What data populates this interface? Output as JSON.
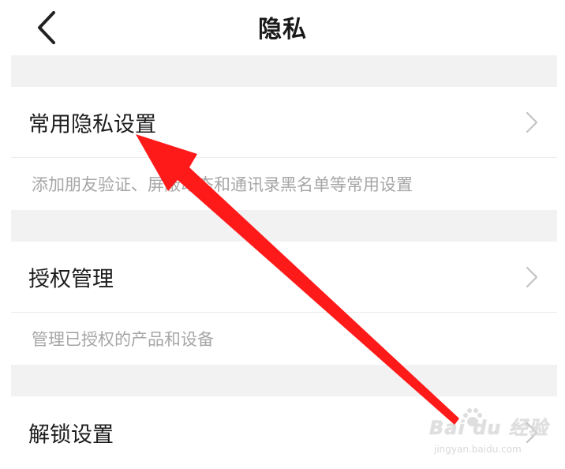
{
  "header": {
    "title": "隐私",
    "back_icon": "chevron-left-icon"
  },
  "items": [
    {
      "label": "常用隐私设置",
      "description": "添加朋友验证、屏蔽动态和通讯录黑名单等常用设置"
    },
    {
      "label": "授权管理",
      "description": "管理已授权的产品和设备"
    },
    {
      "label": "解锁设置"
    }
  ],
  "watermark": {
    "brand": "Bai du 经验",
    "url": "jingyan.baidu.com"
  },
  "colors": {
    "annotation_arrow": "#ff1a1a",
    "section_gap": "#f2f2f2",
    "description_text": "#a6a6a6"
  }
}
